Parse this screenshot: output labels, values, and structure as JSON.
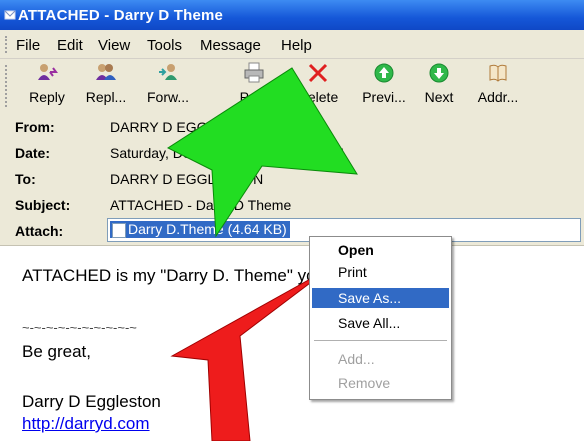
{
  "window": {
    "title": "ATTACHED - Darry D Theme"
  },
  "menu": [
    {
      "label": "File",
      "key": "F"
    },
    {
      "label": "Edit",
      "key": "E"
    },
    {
      "label": "View",
      "key": "V"
    },
    {
      "label": "Tools",
      "key": "T"
    },
    {
      "label": "Message",
      "key": "M"
    },
    {
      "label": "Help",
      "key": "H"
    }
  ],
  "toolbar": [
    {
      "label": "Reply",
      "icon": "reply-icon"
    },
    {
      "label": "Repl...",
      "icon": "reply-all-icon"
    },
    {
      "label": "Forw...",
      "icon": "forward-icon"
    },
    {
      "label": "Print",
      "icon": "print-icon"
    },
    {
      "label": "Delete",
      "icon": "delete-icon"
    },
    {
      "label": "Previ...",
      "icon": "previous-icon"
    },
    {
      "label": "Next",
      "icon": "next-icon"
    },
    {
      "label": "Addr...",
      "icon": "address-book-icon"
    }
  ],
  "header": {
    "from_label": "From:",
    "from": "DARRY D EGGLESTON",
    "date_label": "Date:",
    "date": "Saturday, December ... 2005 6:40 PM",
    "to_label": "To:",
    "to": "DARRY D EGGLESTON",
    "subject_label": "Subject:",
    "subject": "ATTACHED - Darry D Theme",
    "attach_label": "Attach:",
    "attachment": "Darry D.Theme (4.64 KB)"
  },
  "body": {
    "line1": "ATTACHED is my \"Darry D. Theme\" you requested.",
    "sig_sep": "~-~-~-~-~-~-~-~-~-~",
    "closing": "Be great,",
    "name": "Darry D Eggleston",
    "link": "http://darryd.com"
  },
  "context_menu": {
    "open": "Open",
    "print": "Print",
    "save_as": "Save As...",
    "save_all": "Save All...",
    "add": "Add...",
    "remove": "Remove"
  },
  "colors": {
    "titlebar": "#1557d8",
    "selection": "#316ac5",
    "chrome": "#ece9d8",
    "green_arrow": "#22dd22",
    "red_arrow": "#ee1c1c"
  }
}
